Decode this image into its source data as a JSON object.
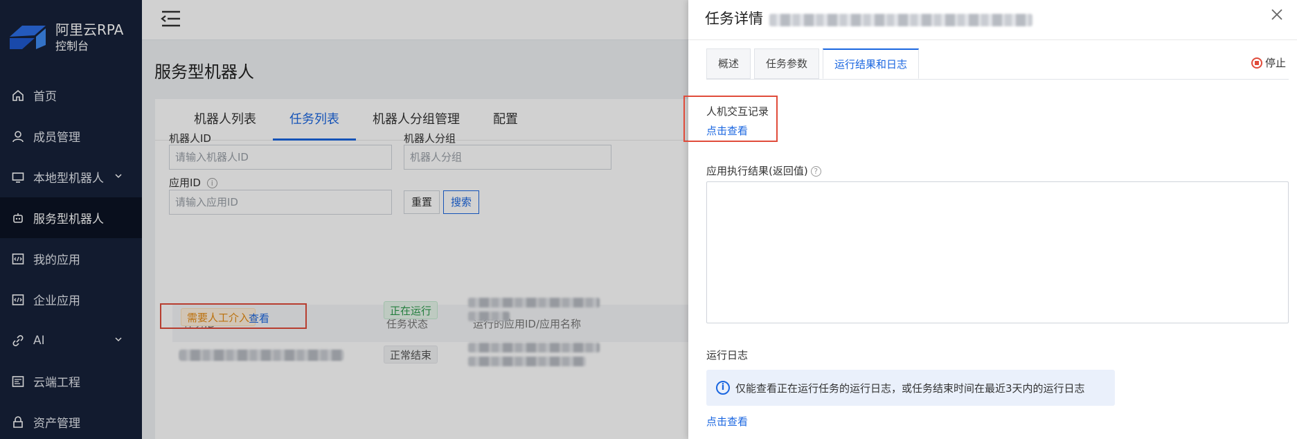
{
  "sidebar": {
    "brand_title": "阿里云RPA",
    "brand_sub": "控制台",
    "items": [
      {
        "label": "首页"
      },
      {
        "label": "成员管理"
      },
      {
        "label": "本地型机器人"
      },
      {
        "label": "服务型机器人"
      },
      {
        "label": "我的应用"
      },
      {
        "label": "企业应用"
      },
      {
        "label": "AI"
      },
      {
        "label": "云端工程"
      },
      {
        "label": "资产管理"
      }
    ]
  },
  "main": {
    "page_title": "服务型机器人",
    "tabs": [
      "机器人列表",
      "任务列表",
      "机器人分组管理",
      "配置"
    ],
    "filters": {
      "robot_id_label": "机器人ID",
      "robot_id_placeholder": "请输入机器人ID",
      "robot_group_label": "机器人分组",
      "robot_group_placeholder": "机器人分组",
      "app_id_label": "应用ID",
      "app_id_placeholder": "请输入应用ID",
      "reset": "重置",
      "search": "搜索"
    },
    "table": {
      "headers": [
        "任务ID",
        "任务状态",
        "运行的应用ID/应用名称"
      ],
      "rows": [
        {
          "tag": "需要人工介入",
          "action": "查看",
          "status": "正在运行"
        },
        {
          "status": "正常结束"
        }
      ]
    }
  },
  "drawer": {
    "title": "任务详情",
    "tabs": [
      "概述",
      "任务参数",
      "运行结果和日志"
    ],
    "stop": "停止",
    "interaction_title": "人机交互记录",
    "interaction_link": "点击查看",
    "result_title": "应用执行结果(返回值)",
    "log_title": "运行日志",
    "log_info": "仅能查看正在运行任务的运行日志，或任务结束时间在最近3天内的运行日志",
    "log_link": "点击查看"
  },
  "colors": {
    "accent": "#1a66e0",
    "sidebar_bg": "#16213a",
    "highlight": "#e04b3a"
  }
}
